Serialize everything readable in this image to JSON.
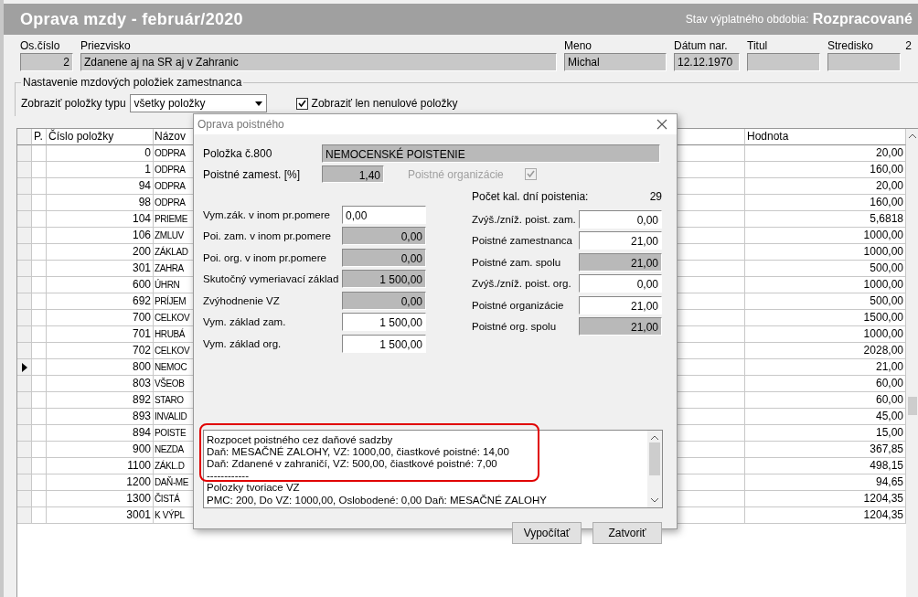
{
  "title": {
    "text": "Oprava mzdy -  február/2020",
    "status_label": "Stav výplatného obdobia:",
    "status_value": "Rozpracované"
  },
  "employee": [
    {
      "label": "Os.číslo",
      "value": "2",
      "kind": "number"
    },
    {
      "label": "Priezvisko",
      "value": "Zdanene aj na SR aj v Zahranic",
      "kind": "text"
    },
    {
      "label": "Meno",
      "value": "Michal",
      "kind": "text"
    },
    {
      "label": "Dátum nar.",
      "value": "12.12.1970",
      "kind": "text"
    },
    {
      "label": "Titul",
      "kind": "text"
    },
    {
      "label": "Stredisko",
      "label_value": "2",
      "kind": "text"
    }
  ],
  "group": {
    "title": "Nastavenie mzdových položiek zamestnanca",
    "filter_label": "Zobraziť položky typu",
    "filter_value": "všetky položky",
    "nonzero_label": "Zobraziť len nenulové položky",
    "nonzero_checked": true
  },
  "table": {
    "columns": [
      "P.",
      "Číslo položky",
      "Názov",
      "Hodnota"
    ],
    "rows": [
      {
        "number": "0",
        "name": "ODPRA",
        "value": "20,00",
        "selected": false
      },
      {
        "number": "1",
        "name": "ODPRA",
        "value": "160,00",
        "selected": false
      },
      {
        "number": "94",
        "name": "ODPRA",
        "value": "20,00",
        "selected": false
      },
      {
        "number": "98",
        "name": "ODPRA",
        "value": "160,00",
        "selected": false
      },
      {
        "number": "104",
        "name": "PRIEME",
        "value": "5,6818",
        "selected": false
      },
      {
        "number": "106",
        "name": "ZMLUV",
        "value": "1000,00",
        "selected": false
      },
      {
        "number": "200",
        "name": "ZÁKLAD",
        "value": "1000,00",
        "selected": false
      },
      {
        "number": "301",
        "name": "ZAHRA",
        "value": "500,00",
        "selected": false
      },
      {
        "number": "600",
        "name": "ÚHRN",
        "value": "1000,00",
        "selected": false
      },
      {
        "number": "692",
        "name": "PRÍJEM",
        "value": "500,00",
        "selected": false
      },
      {
        "number": "700",
        "name": "CELKOV",
        "value": "1500,00",
        "selected": false
      },
      {
        "number": "701",
        "name": "HRUBÁ",
        "value": "1000,00",
        "selected": false
      },
      {
        "number": "702",
        "name": "CELKOV",
        "value": "2028,00",
        "selected": false
      },
      {
        "number": "800",
        "name": "NEMOC",
        "value": "21,00",
        "selected": true
      },
      {
        "number": "803",
        "name": "VŠEOB",
        "value": "60,00",
        "selected": false
      },
      {
        "number": "892",
        "name": "STARO",
        "value": "60,00",
        "selected": false
      },
      {
        "number": "893",
        "name": "INVALID",
        "value": "45,00",
        "selected": false
      },
      {
        "number": "894",
        "name": "POISTE",
        "value": "15,00",
        "selected": false
      },
      {
        "number": "900",
        "name": "NEZDA",
        "value": "367,85",
        "selected": false
      },
      {
        "number": "1100",
        "name": "ZÁKL.D",
        "value": "498,15",
        "selected": false
      },
      {
        "number": "1200",
        "name": "DAŇ-ME",
        "value": "94,65",
        "selected": false
      },
      {
        "number": "1300",
        "name": "ČISTÁ",
        "value": "1204,35",
        "selected": false
      },
      {
        "number": "3001",
        "name": "K VÝPL",
        "value": "1204,35",
        "selected": false
      }
    ]
  },
  "dialog": {
    "title": "Oprava poistného",
    "item_label": "Položka č.800",
    "item_name": "NEMOCENSKÉ POISTENIE",
    "rate_label": "Poistné zamest. [%]",
    "rate_value": "1,40",
    "org_label": "Poistné organizácie",
    "org_checked": true,
    "org_disabled": true,
    "left_fields": [
      {
        "label": "Vym.zák. v inom pr.pomere",
        "value": "0,00",
        "editable": true,
        "kind": "entry"
      },
      {
        "label": "Poi. zam. v inom pr.pomere",
        "value": "0,00",
        "editable": false,
        "kind": "amount"
      },
      {
        "label": "Poi. org. v inom pr.pomere",
        "value": "0,00",
        "editable": false,
        "kind": "amount"
      },
      {
        "label": "Skutočný vymeriavací základ",
        "value": "1 500,00",
        "editable": false,
        "kind": "amount"
      },
      {
        "label": "Zvýhodnenie VZ",
        "value": "0,00",
        "editable": false,
        "kind": "amount"
      },
      {
        "label": "Vym. základ zam.",
        "value": "1 500,00",
        "editable": true,
        "kind": "amount"
      },
      {
        "label": "Vym. základ org.",
        "value": "1 500,00",
        "editable": true,
        "kind": "amount"
      }
    ],
    "days_label": "Počet kal. dní poistenia:",
    "days_value": "29",
    "right_fields": [
      {
        "label": "Zvýš./zníž. poist. zam.",
        "value": "0,00",
        "editable": true
      },
      {
        "label": "Poistné zamestnanca",
        "value": "21,00",
        "editable": true
      },
      {
        "label": "Poistné zam. spolu",
        "value": "21,00",
        "editable": false
      },
      {
        "label": "Zvýš./zníž. poist. org.",
        "value": "0,00",
        "editable": true
      },
      {
        "label": "Poistné organizácie",
        "value": "21,00",
        "editable": true
      },
      {
        "label": "Poistné org. spolu",
        "value": "21,00",
        "editable": false
      }
    ],
    "log_lines": [
      "Rozpocet poistného cez daňové sadzby",
      "Daň: MESAČNÉ ZALOHY, VZ: 1000,00, čiastkové poistné: 14,00",
      "Daň: Zdanené v zahraničí, VZ: 500,00, čiastkové poistné: 7,00",
      "------------",
      "Polozky tvoriace VZ",
      "PMC: 200, Do VZ: 1000,00, Oslobodené: 0,00 Daň: MESAČNÉ ZALOHY"
    ],
    "buttons": [
      "Vypočítať",
      "Zatvoriť"
    ]
  }
}
